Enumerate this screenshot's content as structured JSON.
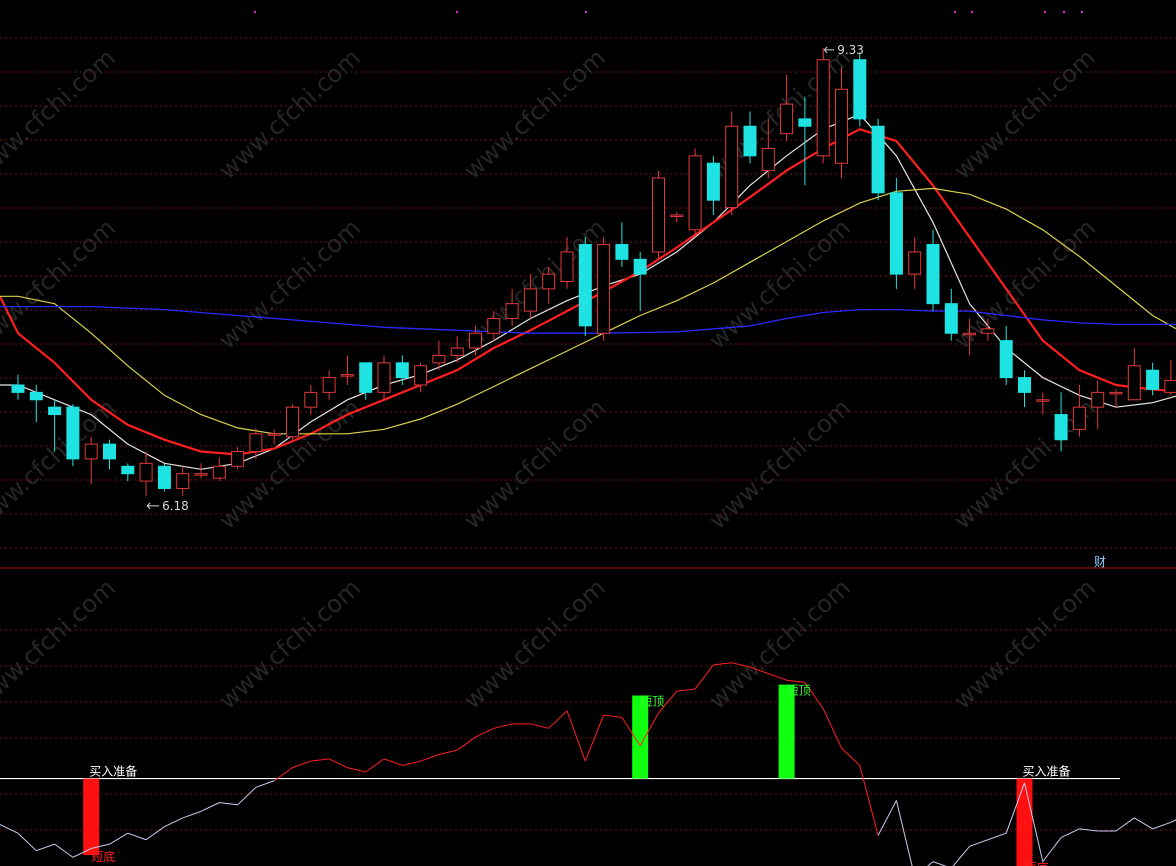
{
  "watermark": "www.cfchi.com",
  "colors": {
    "background": "#000000",
    "grid": "#7a1010",
    "divider": "#b01818",
    "up_candle": "#e23a3a",
    "down_candle": "#1fe3e3",
    "ma_white": "#e6e6e6",
    "ma_red": "#ff1f1f",
    "ma_yellow": "#d9d24a",
    "ma_blue": "#2a2aff",
    "osc_red_segment": "#ff2020",
    "osc_white_segment": "#c8d0f0",
    "bar_bottom": "#ff1010",
    "bar_top": "#10ff10",
    "baseline": "#ffffff",
    "label_white": "#ffffff",
    "label_red": "#ff2020",
    "label_green": "#30ff30",
    "badge": "#8fd0ff"
  },
  "chart_data": [
    {
      "type": "candlestick",
      "title": "",
      "ylim": [
        5.9,
        9.6
      ],
      "high_marker": "9.33",
      "low_marker": "6.18",
      "badge": "财",
      "candles": [
        [
          7.05,
          7.0,
          7.12,
          6.95
        ],
        [
          7.0,
          6.95,
          7.05,
          6.8
        ],
        [
          6.9,
          6.85,
          6.95,
          6.6
        ],
        [
          6.9,
          6.55,
          6.92,
          6.5
        ],
        [
          6.55,
          6.65,
          6.7,
          6.38
        ],
        [
          6.65,
          6.55,
          6.68,
          6.48
        ],
        [
          6.5,
          6.45,
          6.52,
          6.4
        ],
        [
          6.4,
          6.52,
          6.6,
          6.3
        ],
        [
          6.5,
          6.35,
          6.52,
          6.33
        ],
        [
          6.35,
          6.45,
          6.5,
          6.3
        ],
        [
          6.45,
          6.45,
          6.52,
          6.42
        ],
        [
          6.42,
          6.5,
          6.56,
          6.4
        ],
        [
          6.5,
          6.6,
          6.63,
          6.48
        ],
        [
          6.6,
          6.72,
          6.76,
          6.55
        ],
        [
          6.72,
          6.72,
          6.75,
          6.65
        ],
        [
          6.7,
          6.9,
          6.92,
          6.68
        ],
        [
          6.9,
          7.0,
          7.05,
          6.85
        ],
        [
          7.0,
          7.1,
          7.15,
          6.95
        ],
        [
          7.12,
          7.12,
          7.25,
          7.05
        ],
        [
          7.2,
          7.0,
          7.2,
          6.95
        ],
        [
          7.0,
          7.2,
          7.25,
          6.95
        ],
        [
          7.2,
          7.1,
          7.25,
          7.05
        ],
        [
          7.05,
          7.18,
          7.2,
          7.0
        ],
        [
          7.2,
          7.25,
          7.35,
          7.15
        ],
        [
          7.25,
          7.3,
          7.38,
          7.2
        ],
        [
          7.3,
          7.4,
          7.45,
          7.25
        ],
        [
          7.4,
          7.5,
          7.55,
          7.35
        ],
        [
          7.5,
          7.6,
          7.7,
          7.45
        ],
        [
          7.55,
          7.7,
          7.8,
          7.5
        ],
        [
          7.7,
          7.8,
          7.85,
          7.6
        ],
        [
          7.75,
          7.95,
          8.05,
          7.7
        ],
        [
          8.0,
          7.45,
          8.05,
          7.38
        ],
        [
          7.4,
          8.0,
          8.05,
          7.35
        ],
        [
          8.0,
          7.9,
          8.15,
          7.85
        ],
        [
          7.9,
          7.8,
          7.95,
          7.55
        ],
        [
          7.95,
          8.45,
          8.5,
          7.9
        ],
        [
          8.2,
          8.2,
          8.22,
          8.15
        ],
        [
          8.1,
          8.6,
          8.65,
          8.05
        ],
        [
          8.55,
          8.3,
          8.6,
          8.2
        ],
        [
          8.25,
          8.8,
          8.9,
          8.2
        ],
        [
          8.8,
          8.6,
          8.9,
          8.55
        ],
        [
          8.5,
          8.65,
          8.85,
          8.45
        ],
        [
          8.75,
          8.95,
          9.15,
          8.7
        ],
        [
          8.85,
          8.8,
          9.0,
          8.4
        ],
        [
          8.6,
          9.25,
          9.33,
          8.55
        ],
        [
          8.55,
          9.05,
          9.2,
          8.45
        ],
        [
          9.25,
          8.85,
          9.3,
          8.8
        ],
        [
          8.8,
          8.35,
          8.85,
          8.3
        ],
        [
          8.35,
          7.8,
          8.45,
          7.7
        ],
        [
          7.8,
          7.95,
          8.05,
          7.7
        ],
        [
          8.0,
          7.6,
          8.1,
          7.55
        ],
        [
          7.6,
          7.4,
          7.7,
          7.35
        ],
        [
          7.4,
          7.4,
          7.5,
          7.25
        ],
        [
          7.4,
          7.43,
          7.5,
          7.35
        ],
        [
          7.35,
          7.1,
          7.45,
          7.05
        ],
        [
          7.1,
          7.0,
          7.15,
          6.9
        ],
        [
          6.95,
          6.95,
          7.0,
          6.85
        ],
        [
          6.85,
          6.68,
          7.0,
          6.6
        ],
        [
          6.75,
          6.9,
          7.05,
          6.7
        ],
        [
          6.9,
          7.0,
          7.08,
          6.75
        ],
        [
          7.0,
          7.0,
          7.02,
          6.9
        ],
        [
          6.95,
          7.18,
          7.3,
          6.95
        ],
        [
          7.15,
          7.02,
          7.2,
          6.98
        ],
        [
          7.0,
          7.08,
          7.22,
          6.98
        ],
        [
          7.08,
          7.12,
          7.14,
          7.05
        ]
      ],
      "series": [
        {
          "name": "",
          "color_key": "ma_white",
          "points": [
            [
              0,
              7.05
            ],
            [
              2,
              6.95
            ],
            [
              4,
              6.85
            ],
            [
              6,
              6.65
            ],
            [
              8,
              6.52
            ],
            [
              10,
              6.48
            ],
            [
              12,
              6.52
            ],
            [
              14,
              6.62
            ],
            [
              16,
              6.8
            ],
            [
              18,
              6.95
            ],
            [
              20,
              7.05
            ],
            [
              22,
              7.12
            ],
            [
              24,
              7.22
            ],
            [
              26,
              7.35
            ],
            [
              28,
              7.5
            ],
            [
              30,
              7.62
            ],
            [
              32,
              7.72
            ],
            [
              34,
              7.8
            ],
            [
              36,
              7.95
            ],
            [
              38,
              8.15
            ],
            [
              40,
              8.4
            ],
            [
              42,
              8.6
            ],
            [
              44,
              8.78
            ],
            [
              46,
              8.88
            ],
            [
              48,
              8.6
            ],
            [
              50,
              8.15
            ],
            [
              52,
              7.6
            ],
            [
              54,
              7.3
            ],
            [
              56,
              7.1
            ],
            [
              58,
              6.98
            ],
            [
              60,
              6.9
            ],
            [
              62,
              6.93
            ],
            [
              64,
              7.0
            ]
          ]
        },
        {
          "name": "",
          "color_key": "ma_red",
          "points": [
            [
              0,
              7.4
            ],
            [
              2,
              7.2
            ],
            [
              4,
              6.95
            ],
            [
              6,
              6.78
            ],
            [
              8,
              6.68
            ],
            [
              10,
              6.6
            ],
            [
              12,
              6.58
            ],
            [
              14,
              6.62
            ],
            [
              16,
              6.72
            ],
            [
              18,
              6.85
            ],
            [
              20,
              6.95
            ],
            [
              22,
              7.05
            ],
            [
              24,
              7.15
            ],
            [
              26,
              7.3
            ],
            [
              28,
              7.42
            ],
            [
              30,
              7.55
            ],
            [
              32,
              7.68
            ],
            [
              34,
              7.82
            ],
            [
              36,
              7.98
            ],
            [
              38,
              8.15
            ],
            [
              40,
              8.32
            ],
            [
              42,
              8.5
            ],
            [
              44,
              8.65
            ],
            [
              46,
              8.78
            ],
            [
              48,
              8.7
            ],
            [
              50,
              8.4
            ],
            [
              52,
              8.05
            ],
            [
              54,
              7.7
            ],
            [
              56,
              7.35
            ],
            [
              58,
              7.15
            ],
            [
              60,
              7.05
            ],
            [
              62,
              7.02
            ],
            [
              64,
              7.0
            ]
          ]
        },
        {
          "name": "",
          "color_key": "ma_yellow",
          "points": [
            [
              0,
              7.65
            ],
            [
              2,
              7.6
            ],
            [
              4,
              7.4
            ],
            [
              6,
              7.18
            ],
            [
              8,
              6.98
            ],
            [
              10,
              6.85
            ],
            [
              12,
              6.76
            ],
            [
              14,
              6.72
            ],
            [
              16,
              6.72
            ],
            [
              18,
              6.72
            ],
            [
              20,
              6.75
            ],
            [
              22,
              6.82
            ],
            [
              24,
              6.92
            ],
            [
              26,
              7.04
            ],
            [
              28,
              7.16
            ],
            [
              30,
              7.28
            ],
            [
              32,
              7.4
            ],
            [
              34,
              7.52
            ],
            [
              36,
              7.62
            ],
            [
              38,
              7.74
            ],
            [
              40,
              7.88
            ],
            [
              42,
              8.02
            ],
            [
              44,
              8.16
            ],
            [
              46,
              8.28
            ],
            [
              48,
              8.36
            ],
            [
              50,
              8.38
            ],
            [
              52,
              8.34
            ],
            [
              54,
              8.24
            ],
            [
              56,
              8.1
            ],
            [
              58,
              7.92
            ],
            [
              60,
              7.72
            ],
            [
              62,
              7.52
            ],
            [
              64,
              7.38
            ]
          ]
        },
        {
          "name": "",
          "color_key": "ma_blue",
          "points": [
            [
              0,
              7.58
            ],
            [
              4,
              7.58
            ],
            [
              8,
              7.56
            ],
            [
              12,
              7.52
            ],
            [
              16,
              7.48
            ],
            [
              20,
              7.44
            ],
            [
              24,
              7.42
            ],
            [
              28,
              7.4
            ],
            [
              32,
              7.4
            ],
            [
              36,
              7.41
            ],
            [
              40,
              7.45
            ],
            [
              42,
              7.5
            ],
            [
              44,
              7.54
            ],
            [
              46,
              7.56
            ],
            [
              48,
              7.56
            ],
            [
              50,
              7.55
            ],
            [
              52,
              7.55
            ],
            [
              54,
              7.52
            ],
            [
              56,
              7.49
            ],
            [
              58,
              7.47
            ],
            [
              60,
              7.46
            ],
            [
              62,
              7.46
            ],
            [
              64,
              7.46
            ]
          ]
        }
      ]
    },
    {
      "type": "line",
      "title": "",
      "ylim": [
        -40,
        100
      ],
      "baseline": 0,
      "points": [
        [
          -1,
          -21
        ],
        [
          0,
          -25
        ],
        [
          1,
          -33
        ],
        [
          2,
          -30
        ],
        [
          3,
          -36
        ],
        [
          4,
          -32
        ],
        [
          5,
          -30
        ],
        [
          6,
          -25
        ],
        [
          7,
          -28
        ],
        [
          8,
          -22
        ],
        [
          9,
          -18
        ],
        [
          10,
          -15
        ],
        [
          11,
          -11
        ],
        [
          12,
          -12
        ],
        [
          13,
          -4
        ],
        [
          14,
          -1
        ],
        [
          15,
          5
        ],
        [
          16,
          8
        ],
        [
          17,
          9
        ],
        [
          18,
          5
        ],
        [
          19,
          3
        ],
        [
          20,
          9
        ],
        [
          21,
          6
        ],
        [
          22,
          8
        ],
        [
          23,
          11
        ],
        [
          24,
          13
        ],
        [
          25,
          19
        ],
        [
          26,
          23
        ],
        [
          27,
          25
        ],
        [
          28,
          25
        ],
        [
          29,
          23
        ],
        [
          30,
          31
        ],
        [
          31,
          8
        ],
        [
          32,
          29
        ],
        [
          33,
          28
        ],
        [
          34,
          15
        ],
        [
          35,
          30
        ],
        [
          36,
          40
        ],
        [
          37,
          41
        ],
        [
          38,
          52
        ],
        [
          39,
          53
        ],
        [
          40,
          51
        ],
        [
          41,
          48
        ],
        [
          42,
          45
        ],
        [
          43,
          44
        ],
        [
          44,
          32
        ],
        [
          45,
          14
        ],
        [
          46,
          6
        ],
        [
          47,
          -26
        ],
        [
          48,
          -10
        ],
        [
          49,
          -45
        ],
        [
          50,
          -38
        ],
        [
          51,
          -41
        ],
        [
          52,
          -31
        ],
        [
          53,
          -28
        ],
        [
          54,
          -25
        ],
        [
          55,
          -2
        ],
        [
          56,
          -38
        ],
        [
          57,
          -27
        ],
        [
          58,
          -23
        ],
        [
          59,
          -24
        ],
        [
          60,
          -24
        ],
        [
          61,
          -18
        ],
        [
          62,
          -23
        ],
        [
          63,
          -20
        ],
        [
          64,
          -16
        ]
      ],
      "bars": [
        {
          "x": 4,
          "from": 0,
          "to": -35,
          "kind": "bottom",
          "label": "短底"
        },
        {
          "x": 34,
          "from": 0,
          "to": 38,
          "kind": "top",
          "label": "短顶"
        },
        {
          "x": 42,
          "from": 0,
          "to": 43,
          "kind": "top",
          "label": "短顶"
        },
        {
          "x": 55,
          "from": 0,
          "to": -40,
          "kind": "bottom",
          "label": "短底"
        }
      ],
      "annotations": [
        {
          "x": 4,
          "text": "买入准备"
        },
        {
          "x": 55,
          "text": "买入准备"
        }
      ]
    }
  ]
}
